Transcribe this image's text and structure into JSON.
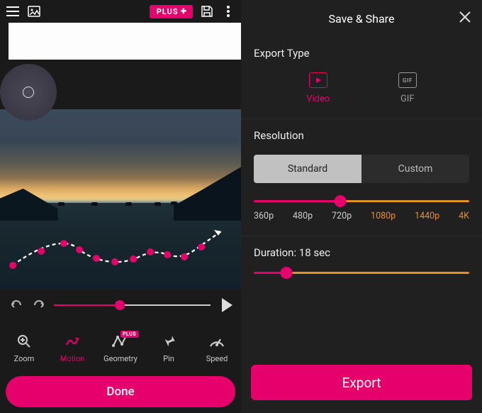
{
  "topbar": {
    "plus_label": "PLUS"
  },
  "tools": {
    "zoom": "Zoom",
    "motion": "Motion",
    "geometry": "Geometry",
    "geometry_badge": "PLUS",
    "pin": "Pin",
    "speed": "Speed"
  },
  "done_label": "Done",
  "right": {
    "title": "Save & Share",
    "export_type_label": "Export Type",
    "export_types": {
      "video": "Video",
      "gif": "GIF",
      "gif_box": "GIF"
    },
    "resolution_label": "Resolution",
    "seg": {
      "standard": "Standard",
      "custom": "Custom"
    },
    "res_values": {
      "r360": "360p",
      "r480": "480p",
      "r720": "720p",
      "r1080": "1080p",
      "r1440": "1440p",
      "r4k": "4K"
    },
    "duration_label": "Duration: 18 sec",
    "export_btn": "Export"
  },
  "timeline": {
    "progress_pct": 42
  },
  "colors": {
    "accent": "#e6006b",
    "premium": "#e39028"
  }
}
